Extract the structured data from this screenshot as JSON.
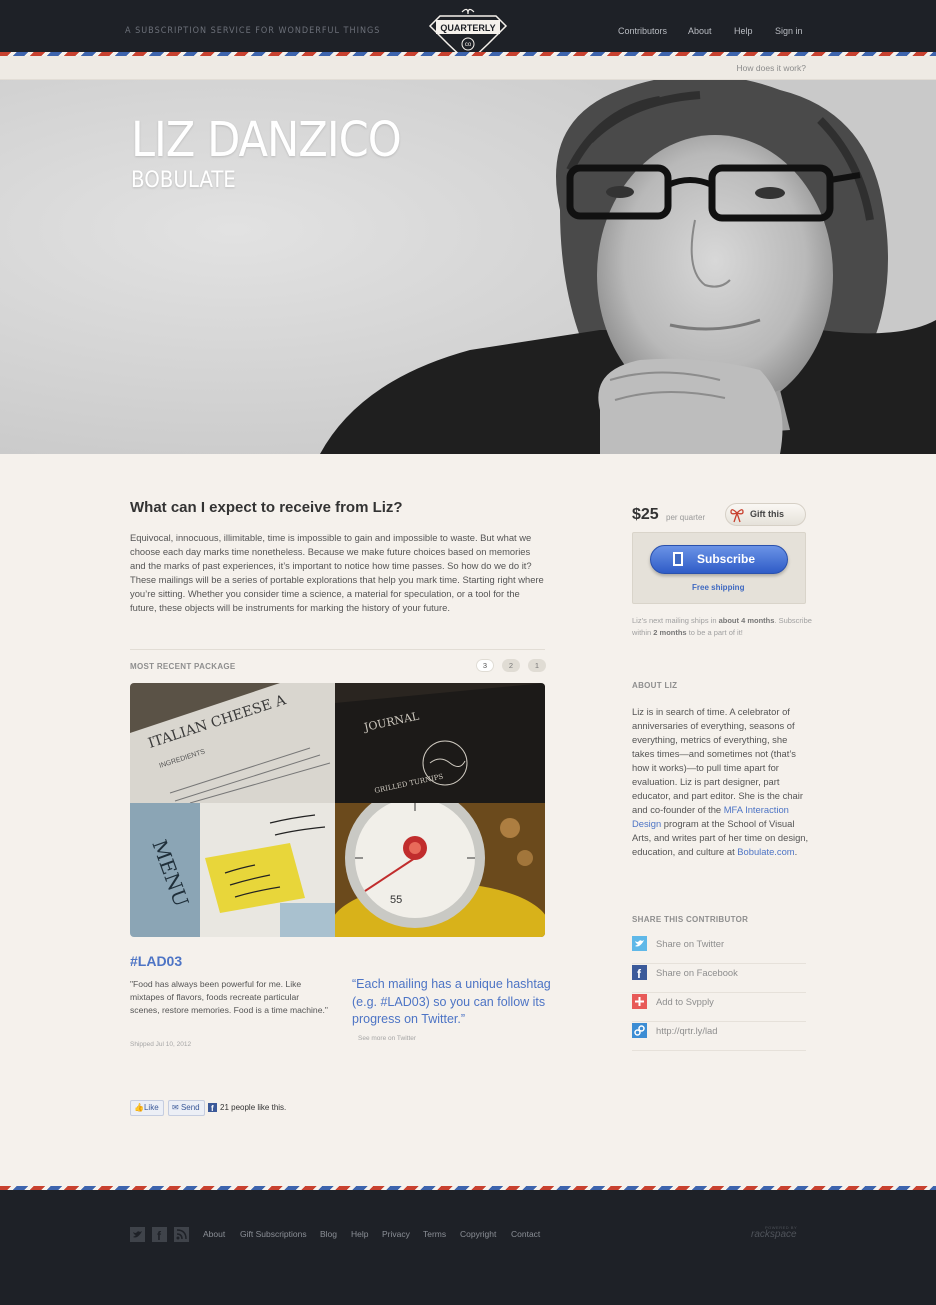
{
  "header": {
    "tagline": "A SUBSCRIPTION SERVICE FOR WONDERFUL THINGS",
    "logo_text": "QUARTERLY",
    "logo_sub": "co",
    "nav": [
      "Contributors",
      "About",
      "Help",
      "Sign in"
    ],
    "how_link": "How does it work?"
  },
  "hero": {
    "name": "LIZ DANZICO",
    "company": "BOBULATE"
  },
  "main": {
    "question": "What can I expect to receive from Liz?",
    "intro": "Equivocal, innocuous, illimitable, time is impossible to gain and impossible to waste. But what we choose each day marks time nonetheless. Because we make future choices based on memories and the marks of past experiences, it’s important to notice how time passes. So how do we do it? These mailings will be a series of portable explorations that help you mark time. Starting right where you’re sitting. Whether you consider time a science, a material for speculation, or a tool for the future, these objects will be instruments for marking the history of your future.",
    "recent_label": "MOST RECENT PACKAGE",
    "package_pages": [
      "3",
      "2",
      "1"
    ],
    "gallery_text": {
      "cheese_title": "ITALIAN CHEESE A",
      "cheese_sub": "INGREDIENTS",
      "journal_title": "JOURNAL",
      "journal_script": "GRILLED TURNIPS",
      "menu_word": "MENU",
      "timer_number": "55"
    },
    "hashtag": "#LAD03",
    "quote": "\"Food has always been powerful for me. Like mixtapes of flavors, foods recreate particular scenes, restore memories. Food is a time machine.\"",
    "shipped": "Shipped Jul 10, 2012",
    "pull_quote": "“Each mailing has a unique hashtag (e.g. #LAD03) so you can follow its progress on Twitter.”",
    "see_more": "See more on Twitter",
    "fb_like": "Like",
    "fb_send": "Send",
    "fb_count": "21 people like this."
  },
  "sidebar": {
    "price": "$25",
    "per": "per quarter",
    "gift": "Gift this",
    "subscribe": "Subscribe",
    "free_shipping": "Free shipping",
    "next_pre": "Liz’s next mailing ships in ",
    "next_bold": "about 4 months",
    "next_mid": ". Subscribe within ",
    "next_bold2": "2 months",
    "next_post": " to be a part of it!",
    "about_label": "ABOUT LIZ",
    "about_pre": "Liz is in search of time. A celebrator of anniversaries of everything, seasons of everything, metrics of everything, she takes times—and sometimes not (that’s how it works)—to pull time apart for evaluation. Liz is part designer, part educator, and part editor. She is the chair and co-founder of the ",
    "about_link1": "MFA Interaction Design",
    "about_mid": " program at the School of Visual Arts, and writes part of her time on design, education, and culture at ",
    "about_link2": "Bobulate.com",
    "about_post": ".",
    "share_label": "SHARE THIS CONTRIBUTOR",
    "share": [
      {
        "label": "Share on Twitter",
        "icon": "twitter-icon",
        "color": "#5fb8e8"
      },
      {
        "label": "Share on Facebook",
        "icon": "facebook-icon",
        "color": "#3b5a9a"
      },
      {
        "label": "Add to Svpply",
        "icon": "svpply-icon",
        "color": "#e85a58"
      },
      {
        "label": "http://qrtr.ly/lad",
        "icon": "link-icon",
        "color": "#3c8dd4"
      }
    ]
  },
  "footer": {
    "links": [
      "About",
      "Gift Subscriptions",
      "Blog",
      "Help",
      "Privacy",
      "Terms",
      "Copyright",
      "Contact"
    ],
    "hosting": "rackspace",
    "hosting_small": "POWERED BY"
  }
}
